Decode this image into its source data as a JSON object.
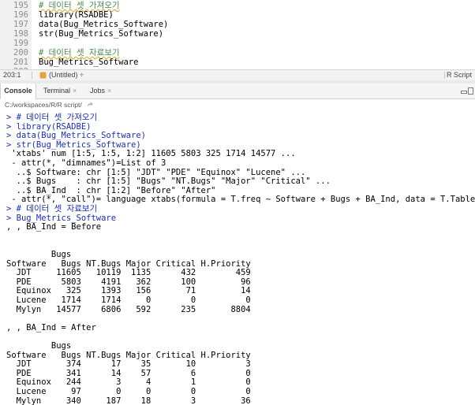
{
  "editor": {
    "lines": [
      {
        "num": "195",
        "text": "# 데이터 셋 가져오기",
        "comment": true
      },
      {
        "num": "196",
        "text": "library(RSADBE)",
        "comment": false
      },
      {
        "num": "197",
        "text": "data(Bug_Metrics_Software)",
        "comment": false
      },
      {
        "num": "198",
        "text": "str(Bug_Metrics_Software)",
        "comment": false
      },
      {
        "num": "199",
        "text": "",
        "comment": false
      },
      {
        "num": "200",
        "text": "# 데이터 셋 자료보기",
        "comment": true
      },
      {
        "num": "201",
        "text": "Bug_Metrics_Software",
        "comment": false
      },
      {
        "num": "202",
        "text": "",
        "comment": false
      }
    ]
  },
  "status": {
    "position": "203:1",
    "scope": "(Untitled) ÷",
    "file_type": "R Script"
  },
  "tabs": [
    {
      "label": "Console",
      "active": true
    },
    {
      "label": "Terminal",
      "active": false
    },
    {
      "label": "Jobs",
      "active": false
    }
  ],
  "path": "C:/workspaces/R/R script/",
  "console": {
    "lines": [
      {
        "text": "> # 데이터 셋 가져오기",
        "kind": "cmt"
      },
      {
        "text": "> library(RSADBE)",
        "kind": "cmd"
      },
      {
        "text": "> data(Bug_Metrics_Software)",
        "kind": "cmd"
      },
      {
        "text": "> str(Bug_Metrics_Software)",
        "kind": "cmd"
      },
      {
        "text": " 'xtabs' num [1:5, 1:5, 1:2] 11605 5803 325 1714 14577 ...",
        "kind": "out"
      },
      {
        "text": " - attr(*, \"dimnames\")=List of 3",
        "kind": "out"
      },
      {
        "text": "  ..$ Software: chr [1:5] \"JDT\" \"PDE\" \"Equinox\" \"Lucene\" ...",
        "kind": "out"
      },
      {
        "text": "  ..$ Bugs    : chr [1:5] \"Bugs\" \"NT.Bugs\" \"Major\" \"Critical\" ...",
        "kind": "out"
      },
      {
        "text": "  ..$ BA_Ind  : chr [1:2] \"Before\" \"After\"",
        "kind": "out"
      },
      {
        "text": " - attr(*, \"call\")= language xtabs(formula = T.freq ~ Software + Bugs + BA_Ind, data = T.Table)",
        "kind": "out"
      },
      {
        "text": "> # 데이터 셋 자료보기",
        "kind": "cmt"
      },
      {
        "text": "> Bug_Metrics_Software",
        "kind": "cmd"
      },
      {
        "text": ", , BA_Ind = Before",
        "kind": "out"
      },
      {
        "text": "",
        "kind": "out"
      },
      {
        "text": "",
        "kind": "out"
      },
      {
        "text": "         Bugs",
        "kind": "out"
      },
      {
        "text": "Software   Bugs NT.Bugs Major Critical H.Priority",
        "kind": "out"
      },
      {
        "text": "  JDT     11605   10119  1135      432        459",
        "kind": "out"
      },
      {
        "text": "  PDE      5803    4191   362      100         96",
        "kind": "out"
      },
      {
        "text": "  Equinox   325    1393   156       71         14",
        "kind": "out"
      },
      {
        "text": "  Lucene   1714    1714     0        0          0",
        "kind": "out"
      },
      {
        "text": "  Mylyn   14577    6806   592      235       8804",
        "kind": "out"
      },
      {
        "text": "",
        "kind": "out"
      },
      {
        "text": ", , BA_Ind = After",
        "kind": "out"
      },
      {
        "text": "",
        "kind": "out"
      },
      {
        "text": "         Bugs",
        "kind": "out"
      },
      {
        "text": "Software   Bugs NT.Bugs Major Critical H.Priority",
        "kind": "out"
      },
      {
        "text": "  JDT       374      17    35       10          3",
        "kind": "out"
      },
      {
        "text": "  PDE       341      14    57        6          0",
        "kind": "out"
      },
      {
        "text": "  Equinox   244       3     4        1          0",
        "kind": "out"
      },
      {
        "text": "  Lucene     97       0     0        0          0",
        "kind": "out"
      },
      {
        "text": "  Mylyn     340     187    18        3         36",
        "kind": "out"
      }
    ]
  }
}
